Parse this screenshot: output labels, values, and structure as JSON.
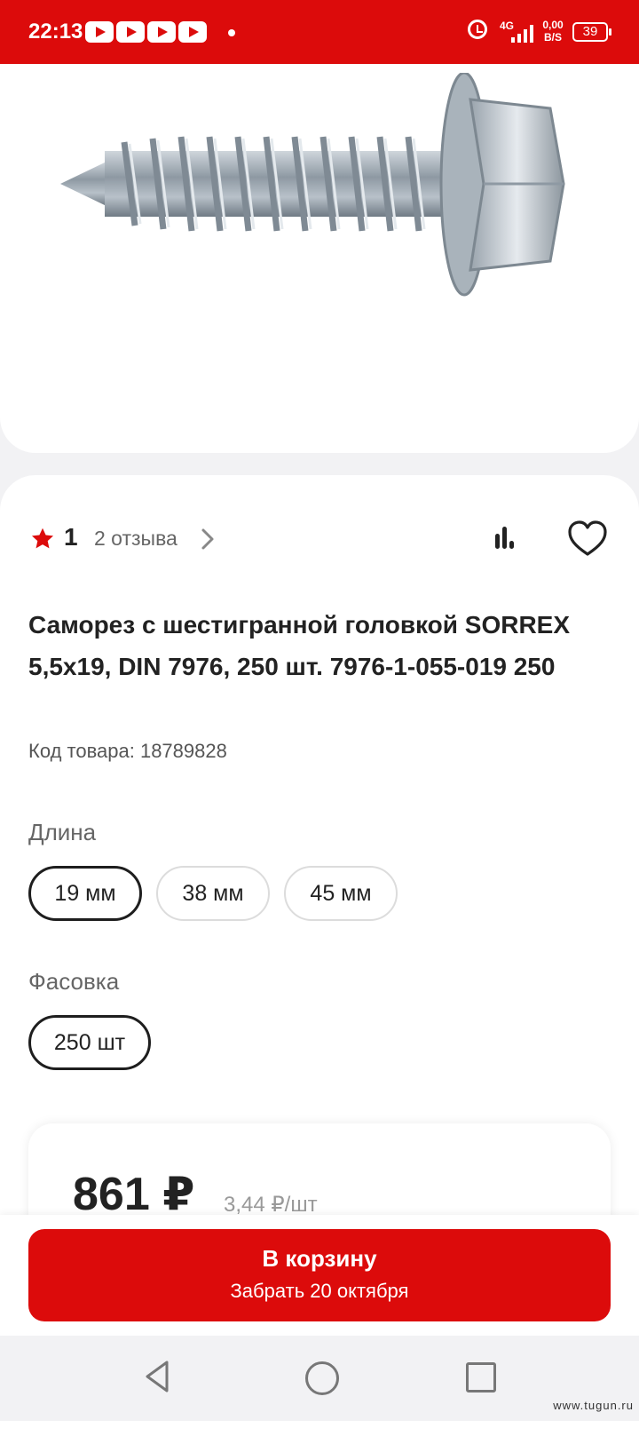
{
  "status_bar": {
    "time": "22:13",
    "network_type": "4G",
    "net_speed_value": "0,00",
    "net_speed_unit": "B/S",
    "battery": "39"
  },
  "product": {
    "rating": "1",
    "reviews_label": "2 отзыва",
    "title": "Саморез с шестигранной головкой SORREX 5,5x19, DIN 7976, 250 шт. 7976-1-055-019 250",
    "sku_label": "Код товара: 18789828"
  },
  "options": {
    "length_label": "Длина",
    "lengths": [
      "19 мм",
      "38 мм",
      "45 мм"
    ],
    "selected_length": "19 мм",
    "pack_label": "Фасовка",
    "packs": [
      "250 шт"
    ],
    "selected_pack": "250 шт"
  },
  "price": {
    "value": "861 ₽",
    "unit_price": "3,44 ₽/шт"
  },
  "cart_button": {
    "label": "В корзину",
    "sublabel": "Забрать 20 октября"
  },
  "watermark": "www.tugun.ru",
  "colors": {
    "brand_red": "#dc0b0b",
    "star": "#dc0b0b",
    "selected_chip_border": "#1e1e1e"
  }
}
